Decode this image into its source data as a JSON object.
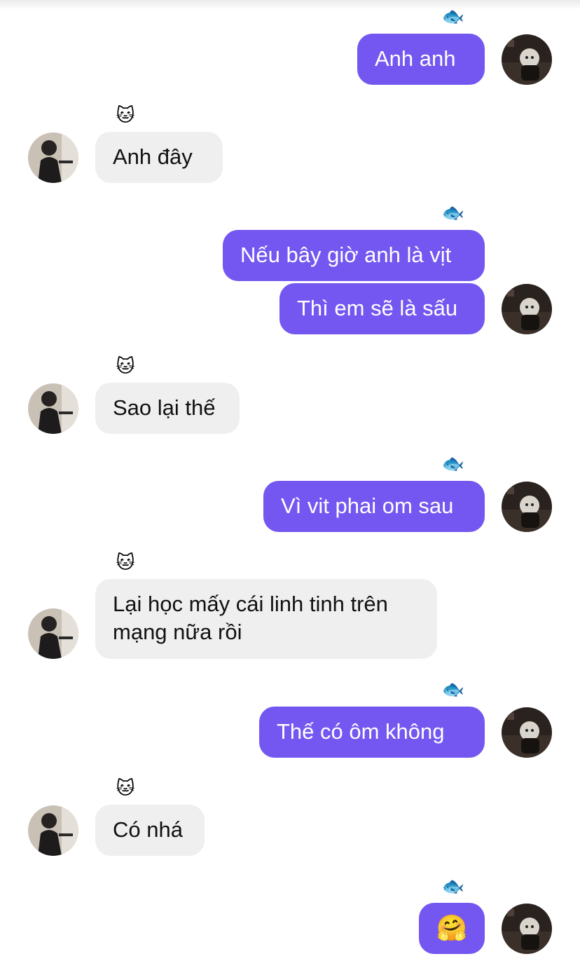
{
  "colors": {
    "outgoing_bubble": "#7457f0",
    "incoming_bubble": "#efefef",
    "outgoing_text": "#ffffff",
    "incoming_text": "#111111"
  },
  "reaction_icons": {
    "outgoing": "🐟",
    "incoming": "🐱"
  },
  "messages": [
    {
      "side": "out",
      "lines": [
        "Anh anh"
      ]
    },
    {
      "side": "in",
      "lines": [
        "Anh đây"
      ]
    },
    {
      "side": "out",
      "lines": [
        "Nếu bây giờ anh là vịt"
      ]
    },
    {
      "side": "out",
      "lines": [
        "Thì em sẽ là sấu"
      ]
    },
    {
      "side": "in",
      "lines": [
        "Sao lại thế"
      ]
    },
    {
      "side": "out",
      "lines": [
        "Vì vit phai om sau"
      ]
    },
    {
      "side": "in",
      "lines": [
        "Lại học mấy cái linh tinh trên",
        "mạng nữa rồi"
      ]
    },
    {
      "side": "out",
      "lines": [
        "Thế có ôm không"
      ]
    },
    {
      "side": "in",
      "lines": [
        "Có nhá"
      ]
    },
    {
      "side": "out",
      "lines": [
        "🤗"
      ],
      "icon": "hugging-face-emoji"
    }
  ]
}
